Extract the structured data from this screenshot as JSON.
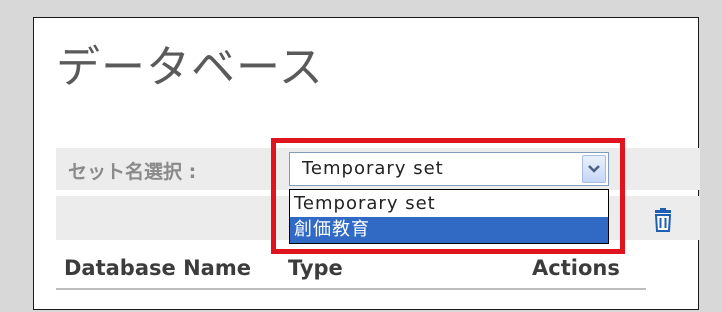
{
  "page": {
    "title": "データベース"
  },
  "filter": {
    "label": "セット名選択 :",
    "selected": "Temporary set",
    "options": [
      "Temporary set",
      "創価教育"
    ],
    "highlighted_index": 1
  },
  "toolbar": {
    "delete_icon": "trash-icon"
  },
  "table": {
    "columns": [
      "Database Name",
      "Type",
      "Actions"
    ]
  },
  "colors": {
    "highlight_border": "#e0141c",
    "selected_option_bg": "#316ac5",
    "panel_bg": "#ffffff",
    "page_bg": "#d8d8d8"
  }
}
